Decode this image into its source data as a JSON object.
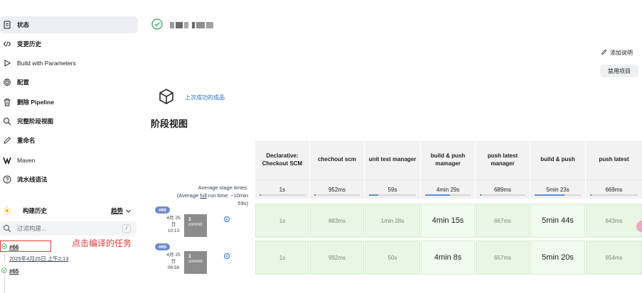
{
  "sidebar": {
    "items": [
      {
        "label": "状态",
        "icon": "document-icon",
        "active": true
      },
      {
        "label": "变更历史",
        "icon": "code-icon"
      },
      {
        "label": "Build with Parameters",
        "icon": "play-icon"
      },
      {
        "label": "配置",
        "icon": "gear-icon"
      },
      {
        "label": "删除 Pipeline",
        "icon": "trash-icon"
      },
      {
        "label": "完整阶段视图",
        "icon": "search-icon"
      },
      {
        "label": "重命名",
        "icon": "pencil-icon"
      },
      {
        "label": "Maven",
        "icon": "maven-icon"
      },
      {
        "label": "流水线语法",
        "icon": "help-icon"
      }
    ]
  },
  "history": {
    "title": "构建历史",
    "trend_label": "趋势",
    "filter_placeholder": "过滤构建...",
    "filter_shortcut": "/",
    "builds": [
      {
        "number": "#66",
        "date": "2025年4月25日 上午2:13"
      },
      {
        "number": "#65"
      }
    ],
    "annotation": "点击编译的任务"
  },
  "main": {
    "add_description": "添加说明",
    "disable_project": "禁用项目",
    "last_artifacts": "上次成功的成品",
    "stage_view_title": "阶段视图"
  },
  "stage_view": {
    "avg_label_1": "Average stage times:",
    "avg_label_2a": "(Average ",
    "avg_label_2b": "full",
    "avg_label_2c": " run time: ~10min",
    "avg_label_3": "59s)",
    "stages": [
      {
        "name": "Declarative: Checkout SCM",
        "avg": "1s",
        "bar": 0.02
      },
      {
        "name": "chechout scm",
        "avg": "952ms",
        "bar": 0.01
      },
      {
        "name": "unit test manager",
        "avg": "59s",
        "bar": 0.2
      },
      {
        "name": "build & push mamager",
        "avg": "4min 29s",
        "bar": 0.55
      },
      {
        "name": "push latest manager",
        "avg": "689ms",
        "bar": 0.01
      },
      {
        "name": "build & push",
        "avg": "5min 23s",
        "bar": 0.65
      },
      {
        "name": "push latest",
        "avg": "669ms",
        "bar": 0.01
      }
    ],
    "runs": [
      {
        "badge": "#66",
        "date_line1": "4月 25",
        "date_line2": "日",
        "time": "10:13",
        "commit_count": "1",
        "commit_label": "commit",
        "times": [
          "1s",
          "883ms",
          "1min 28s",
          "4min 15s",
          "667ms",
          "5min 44s",
          "643ms"
        ]
      },
      {
        "badge": "#65",
        "date_line1": "4月 25",
        "date_line2": "日",
        "time": "08:58",
        "commit_count": "1",
        "commit_label": "commit",
        "times": [
          "1s",
          "992ms",
          "50s",
          "4min 8s",
          "657ms",
          "5min 20s",
          "654ms"
        ]
      }
    ]
  },
  "colors": {
    "accent_blue": "#1f6fd1",
    "success_green": "#2e9e4f",
    "annotation_red": "#e53935"
  }
}
